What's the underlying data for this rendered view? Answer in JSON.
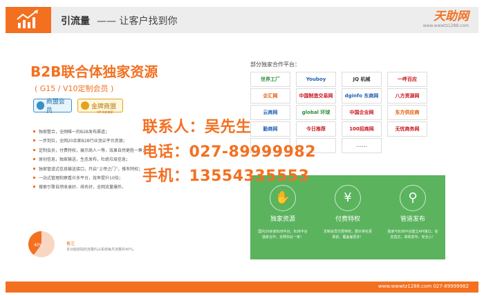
{
  "header": {
    "title": "引流量",
    "subtitle": "—— 让客户找到你",
    "logo_main": "天助网",
    "logo_url": "www.wwwtz1288.com"
  },
  "left": {
    "headline": "B2B联合体独家资源",
    "member_type": "( G15 / V10定制会员 )",
    "badges": [
      {
        "label": "商盟会员"
      },
      {
        "label": "金牌商盟"
      }
    ],
    "badge_sub": "VIP·优质商家",
    "bullets": [
      "独家整合，全网唯一的B2B发布渠道；",
      "一步到位，全网20余家B2B行业顶尖平台资源；",
      "定制会员，付费特权，展示商人一等，效果自然更胜一筹；",
      "原创信息，独家输送，生态发布，杜绝垃圾信息；",
      "独家管道式信息输送接口，开启“上帝之门”，推有特权；",
      "一站式管理和察看众多平台，效率提升10倍；",
      "搜索引擎自然收录好、排名好，全网流量爆炸。"
    ],
    "pie_percent": 40,
    "pie_label": "40%",
    "pie_tip_title": "备注",
    "pie_tip_text": "本功能获取的流量约占系统每月流量的40%。"
  },
  "partners": {
    "title": "部分独家合作平台：",
    "items": [
      {
        "label": "世界工厂",
        "color": "#2a8c3a"
      },
      {
        "label": "Youboy",
        "color": "#1e5fb3"
      },
      {
        "label": "JQ 机械",
        "color": "#333333"
      },
      {
        "label": "一呼百应",
        "color": "#c8161d"
      },
      {
        "label": "企汇网",
        "color": "#e05a00"
      },
      {
        "label": "中国制造交易网",
        "color": "#c8161d"
      },
      {
        "label": "dginfo 东商网",
        "color": "#1e5fb3"
      },
      {
        "label": "八方资源网",
        "color": "#c8161d"
      },
      {
        "label": "云商网",
        "color": "#1e5fb3"
      },
      {
        "label": "global 环球",
        "color": "#2a8c3a"
      },
      {
        "label": "中国企业网",
        "color": "#c8161d"
      },
      {
        "label": "东方供应商",
        "color": "#e05a00"
      },
      {
        "label": "勤商网",
        "color": "#1e5fb3"
      },
      {
        "label": "今日推荐",
        "color": "#c8161d"
      },
      {
        "label": "100招商网",
        "color": "#c8161d"
      },
      {
        "label": "无忧商务网",
        "color": "#c8161d"
      },
      {
        "label": "",
        "color": "#999999"
      },
      {
        "label": "",
        "color": "#999999"
      },
      {
        "label": "......",
        "color": "#999999"
      }
    ]
  },
  "contact": {
    "person": "联系人：吴先生",
    "phone": "电话：027-89999982",
    "mobile": "手机：13554335553"
  },
  "features": [
    {
      "icon": "handshake",
      "title": "独家资源",
      "desc": "国内20余家B2B平台，B2B平台独家合作，全网仅此一家！"
    },
    {
      "icon": "yen",
      "title": "付费特权",
      "desc": "定制会员付费特权，展示排名更靠前，覆盖面更多！"
    },
    {
      "icon": "faucet",
      "title": "管道发布",
      "desc": "独家与B2B平台建立API接口，信息直达，高效发布，安全心！"
    }
  ],
  "footer": {
    "text": "www.wwwtz1288.com    027-89999982"
  }
}
